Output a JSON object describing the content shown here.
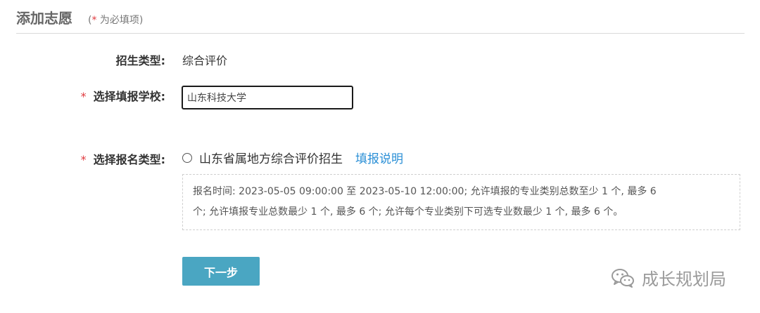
{
  "header": {
    "title": "添加志愿",
    "required_note_open": "(",
    "required_star": "*",
    "required_note_text": " 为必填项)"
  },
  "form": {
    "enroll_type": {
      "label": "招生类型:",
      "value": "综合评价"
    },
    "school": {
      "required_star": "*",
      "label": "选择填报学校:",
      "value": "山东科技大学"
    },
    "apply_type": {
      "required_star": "*",
      "label": "选择报名类型:",
      "option_label": "山东省属地方综合评价招生",
      "option_selected": false,
      "help_link": "填报说明",
      "info_line1": "报名时间: 2023-05-05 09:00:00 至 2023-05-10 12:00:00; 允许填报的专业类别总数至少 1 个, 最多 6",
      "info_line2": "个; 允许填报专业总数最少 1 个, 最多 6 个; 允许每个专业类别下可选专业数最少 1 个, 最多 6 个。"
    }
  },
  "actions": {
    "next_label": "下一步"
  },
  "watermark": {
    "text": "成长规划局",
    "icon": "wechat-icon"
  },
  "colors": {
    "required": "#e0393e",
    "link": "#2a8fd6",
    "button": "#4aa6c2"
  }
}
